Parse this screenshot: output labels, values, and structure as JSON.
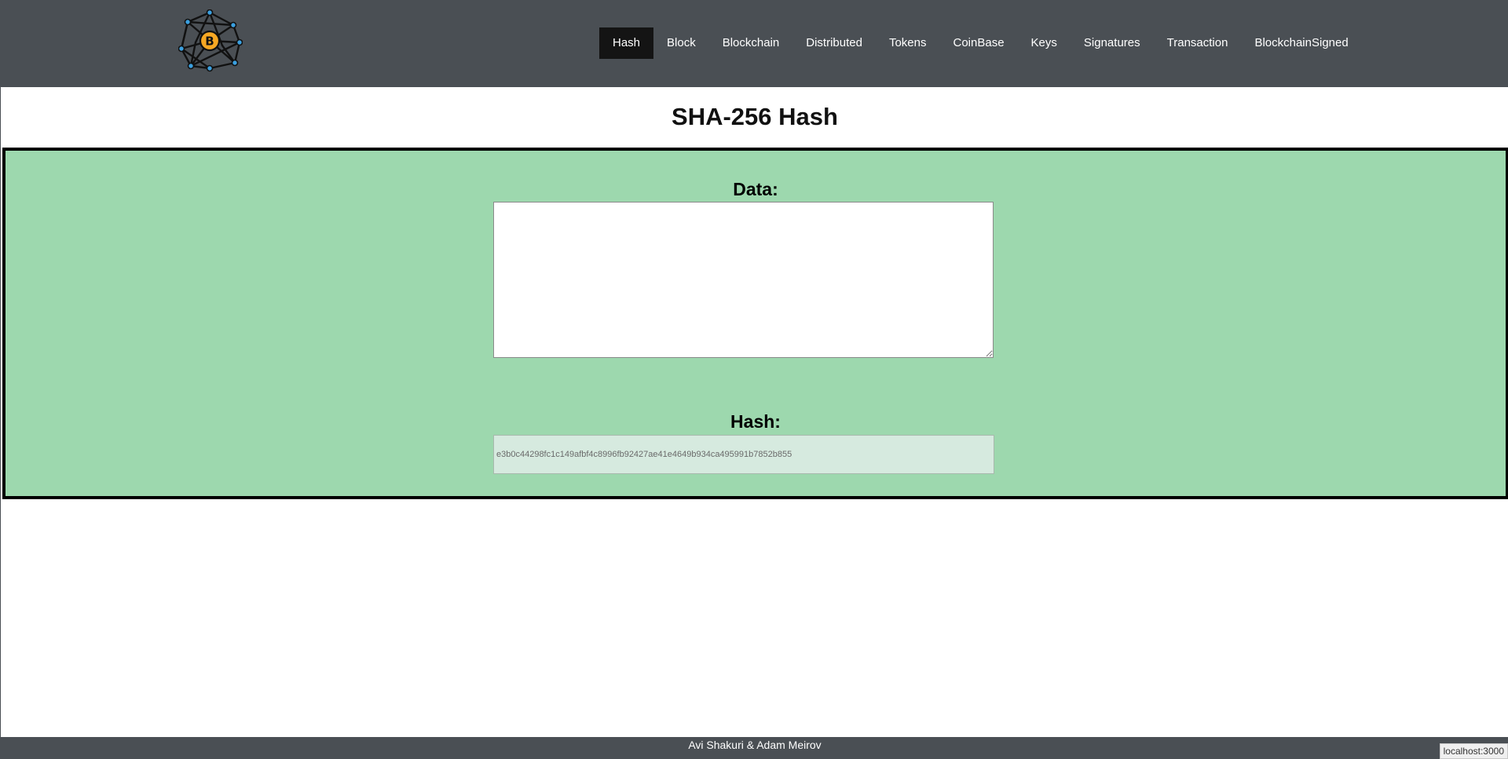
{
  "navbar": {
    "logo_icon": "blockchain-network-bitcoin-logo",
    "logo_glyph": "B",
    "items": [
      {
        "label": "Hash",
        "active": true
      },
      {
        "label": "Block",
        "active": false
      },
      {
        "label": "Blockchain",
        "active": false
      },
      {
        "label": "Distributed",
        "active": false
      },
      {
        "label": "Tokens",
        "active": false
      },
      {
        "label": "CoinBase",
        "active": false
      },
      {
        "label": "Keys",
        "active": false
      },
      {
        "label": "Signatures",
        "active": false
      },
      {
        "label": "Transaction",
        "active": false
      },
      {
        "label": "BlockchainSigned",
        "active": false
      }
    ]
  },
  "main": {
    "title": "SHA-256 Hash",
    "data_label": "Data:",
    "data_value": "",
    "hash_label": "Hash:",
    "hash_value": "e3b0c44298fc1c149afbf4c8996fb92427ae41e4649b934ca495991b7852b855"
  },
  "footer": {
    "credits": "Avi Shakuri & Adam Meirov"
  },
  "status_bar": {
    "url": "localhost:3000"
  },
  "colors": {
    "navbar_bg": "#4a4f54",
    "nav_active_bg": "#141414",
    "panel_bg": "#9dd8ae",
    "hash_field_bg": "#d6eadf",
    "logo_orange": "#f7a823",
    "logo_node_blue": "#3ba0e0"
  }
}
